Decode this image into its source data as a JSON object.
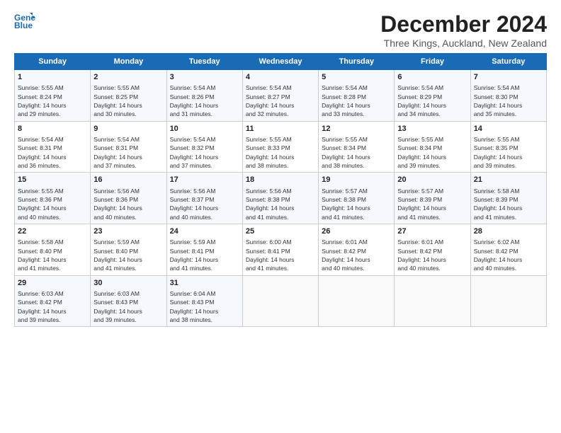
{
  "logo": {
    "line1": "General",
    "line2": "Blue"
  },
  "title": "December 2024",
  "subtitle": "Three Kings, Auckland, New Zealand",
  "header_days": [
    "Sunday",
    "Monday",
    "Tuesday",
    "Wednesday",
    "Thursday",
    "Friday",
    "Saturday"
  ],
  "weeks": [
    [
      {
        "day": "1",
        "sunrise": "Sunrise: 5:55 AM",
        "sunset": "Sunset: 8:24 PM",
        "daylight": "Daylight: 14 hours and 29 minutes."
      },
      {
        "day": "2",
        "sunrise": "Sunrise: 5:55 AM",
        "sunset": "Sunset: 8:25 PM",
        "daylight": "Daylight: 14 hours and 30 minutes."
      },
      {
        "day": "3",
        "sunrise": "Sunrise: 5:54 AM",
        "sunset": "Sunset: 8:26 PM",
        "daylight": "Daylight: 14 hours and 31 minutes."
      },
      {
        "day": "4",
        "sunrise": "Sunrise: 5:54 AM",
        "sunset": "Sunset: 8:27 PM",
        "daylight": "Daylight: 14 hours and 32 minutes."
      },
      {
        "day": "5",
        "sunrise": "Sunrise: 5:54 AM",
        "sunset": "Sunset: 8:28 PM",
        "daylight": "Daylight: 14 hours and 33 minutes."
      },
      {
        "day": "6",
        "sunrise": "Sunrise: 5:54 AM",
        "sunset": "Sunset: 8:29 PM",
        "daylight": "Daylight: 14 hours and 34 minutes."
      },
      {
        "day": "7",
        "sunrise": "Sunrise: 5:54 AM",
        "sunset": "Sunset: 8:30 PM",
        "daylight": "Daylight: 14 hours and 35 minutes."
      }
    ],
    [
      {
        "day": "8",
        "sunrise": "Sunrise: 5:54 AM",
        "sunset": "Sunset: 8:31 PM",
        "daylight": "Daylight: 14 hours and 36 minutes."
      },
      {
        "day": "9",
        "sunrise": "Sunrise: 5:54 AM",
        "sunset": "Sunset: 8:31 PM",
        "daylight": "Daylight: 14 hours and 37 minutes."
      },
      {
        "day": "10",
        "sunrise": "Sunrise: 5:54 AM",
        "sunset": "Sunset: 8:32 PM",
        "daylight": "Daylight: 14 hours and 37 minutes."
      },
      {
        "day": "11",
        "sunrise": "Sunrise: 5:55 AM",
        "sunset": "Sunset: 8:33 PM",
        "daylight": "Daylight: 14 hours and 38 minutes."
      },
      {
        "day": "12",
        "sunrise": "Sunrise: 5:55 AM",
        "sunset": "Sunset: 8:34 PM",
        "daylight": "Daylight: 14 hours and 38 minutes."
      },
      {
        "day": "13",
        "sunrise": "Sunrise: 5:55 AM",
        "sunset": "Sunset: 8:34 PM",
        "daylight": "Daylight: 14 hours and 39 minutes."
      },
      {
        "day": "14",
        "sunrise": "Sunrise: 5:55 AM",
        "sunset": "Sunset: 8:35 PM",
        "daylight": "Daylight: 14 hours and 39 minutes."
      }
    ],
    [
      {
        "day": "15",
        "sunrise": "Sunrise: 5:55 AM",
        "sunset": "Sunset: 8:36 PM",
        "daylight": "Daylight: 14 hours and 40 minutes."
      },
      {
        "day": "16",
        "sunrise": "Sunrise: 5:56 AM",
        "sunset": "Sunset: 8:36 PM",
        "daylight": "Daylight: 14 hours and 40 minutes."
      },
      {
        "day": "17",
        "sunrise": "Sunrise: 5:56 AM",
        "sunset": "Sunset: 8:37 PM",
        "daylight": "Daylight: 14 hours and 40 minutes."
      },
      {
        "day": "18",
        "sunrise": "Sunrise: 5:56 AM",
        "sunset": "Sunset: 8:38 PM",
        "daylight": "Daylight: 14 hours and 41 minutes."
      },
      {
        "day": "19",
        "sunrise": "Sunrise: 5:57 AM",
        "sunset": "Sunset: 8:38 PM",
        "daylight": "Daylight: 14 hours and 41 minutes."
      },
      {
        "day": "20",
        "sunrise": "Sunrise: 5:57 AM",
        "sunset": "Sunset: 8:39 PM",
        "daylight": "Daylight: 14 hours and 41 minutes."
      },
      {
        "day": "21",
        "sunrise": "Sunrise: 5:58 AM",
        "sunset": "Sunset: 8:39 PM",
        "daylight": "Daylight: 14 hours and 41 minutes."
      }
    ],
    [
      {
        "day": "22",
        "sunrise": "Sunrise: 5:58 AM",
        "sunset": "Sunset: 8:40 PM",
        "daylight": "Daylight: 14 hours and 41 minutes."
      },
      {
        "day": "23",
        "sunrise": "Sunrise: 5:59 AM",
        "sunset": "Sunset: 8:40 PM",
        "daylight": "Daylight: 14 hours and 41 minutes."
      },
      {
        "day": "24",
        "sunrise": "Sunrise: 5:59 AM",
        "sunset": "Sunset: 8:41 PM",
        "daylight": "Daylight: 14 hours and 41 minutes."
      },
      {
        "day": "25",
        "sunrise": "Sunrise: 6:00 AM",
        "sunset": "Sunset: 8:41 PM",
        "daylight": "Daylight: 14 hours and 41 minutes."
      },
      {
        "day": "26",
        "sunrise": "Sunrise: 6:01 AM",
        "sunset": "Sunset: 8:42 PM",
        "daylight": "Daylight: 14 hours and 40 minutes."
      },
      {
        "day": "27",
        "sunrise": "Sunrise: 6:01 AM",
        "sunset": "Sunset: 8:42 PM",
        "daylight": "Daylight: 14 hours and 40 minutes."
      },
      {
        "day": "28",
        "sunrise": "Sunrise: 6:02 AM",
        "sunset": "Sunset: 8:42 PM",
        "daylight": "Daylight: 14 hours and 40 minutes."
      }
    ],
    [
      {
        "day": "29",
        "sunrise": "Sunrise: 6:03 AM",
        "sunset": "Sunset: 8:42 PM",
        "daylight": "Daylight: 14 hours and 39 minutes."
      },
      {
        "day": "30",
        "sunrise": "Sunrise: 6:03 AM",
        "sunset": "Sunset: 8:43 PM",
        "daylight": "Daylight: 14 hours and 39 minutes."
      },
      {
        "day": "31",
        "sunrise": "Sunrise: 6:04 AM",
        "sunset": "Sunset: 8:43 PM",
        "daylight": "Daylight: 14 hours and 38 minutes."
      },
      null,
      null,
      null,
      null
    ]
  ]
}
